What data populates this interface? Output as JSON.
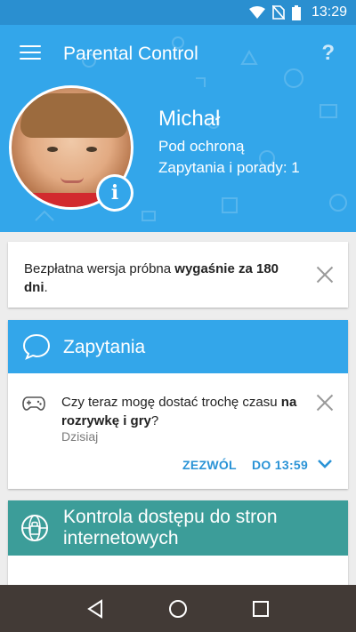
{
  "status_bar": {
    "time": "13:29",
    "icons": [
      "wifi-icon",
      "no-sim-icon",
      "battery-icon"
    ]
  },
  "header": {
    "title": "Parental Control",
    "menu_icon": "hamburger-menu-icon",
    "help_icon": "?",
    "child": {
      "name": "Michał",
      "status": "Pod ochroną",
      "requests_label": "Zapytania i porady: 1"
    },
    "info_badge": "i"
  },
  "trial_banner": {
    "text_before": "Bezpłatna wersja próbna ",
    "text_bold": "wygaśnie za 180 dni",
    "text_after": "."
  },
  "requests": {
    "title": "Zapytania",
    "items": [
      {
        "text_before": "Czy teraz mogę dostać trochę czasu ",
        "text_bold": "na rozrywkę i gry",
        "text_after": "?",
        "date": "Dzisiaj",
        "allow_label": "ZEZWÓL",
        "until_label": "DO 13:59"
      }
    ]
  },
  "web_control": {
    "title": "Kontrola dostępu do stron internetowych"
  },
  "colors": {
    "header_blue": "#33a6ea",
    "status_blue": "#2a8fd0",
    "teal": "#3c9d99",
    "action_blue": "#2a93d6",
    "nav_bar": "#423a36"
  }
}
